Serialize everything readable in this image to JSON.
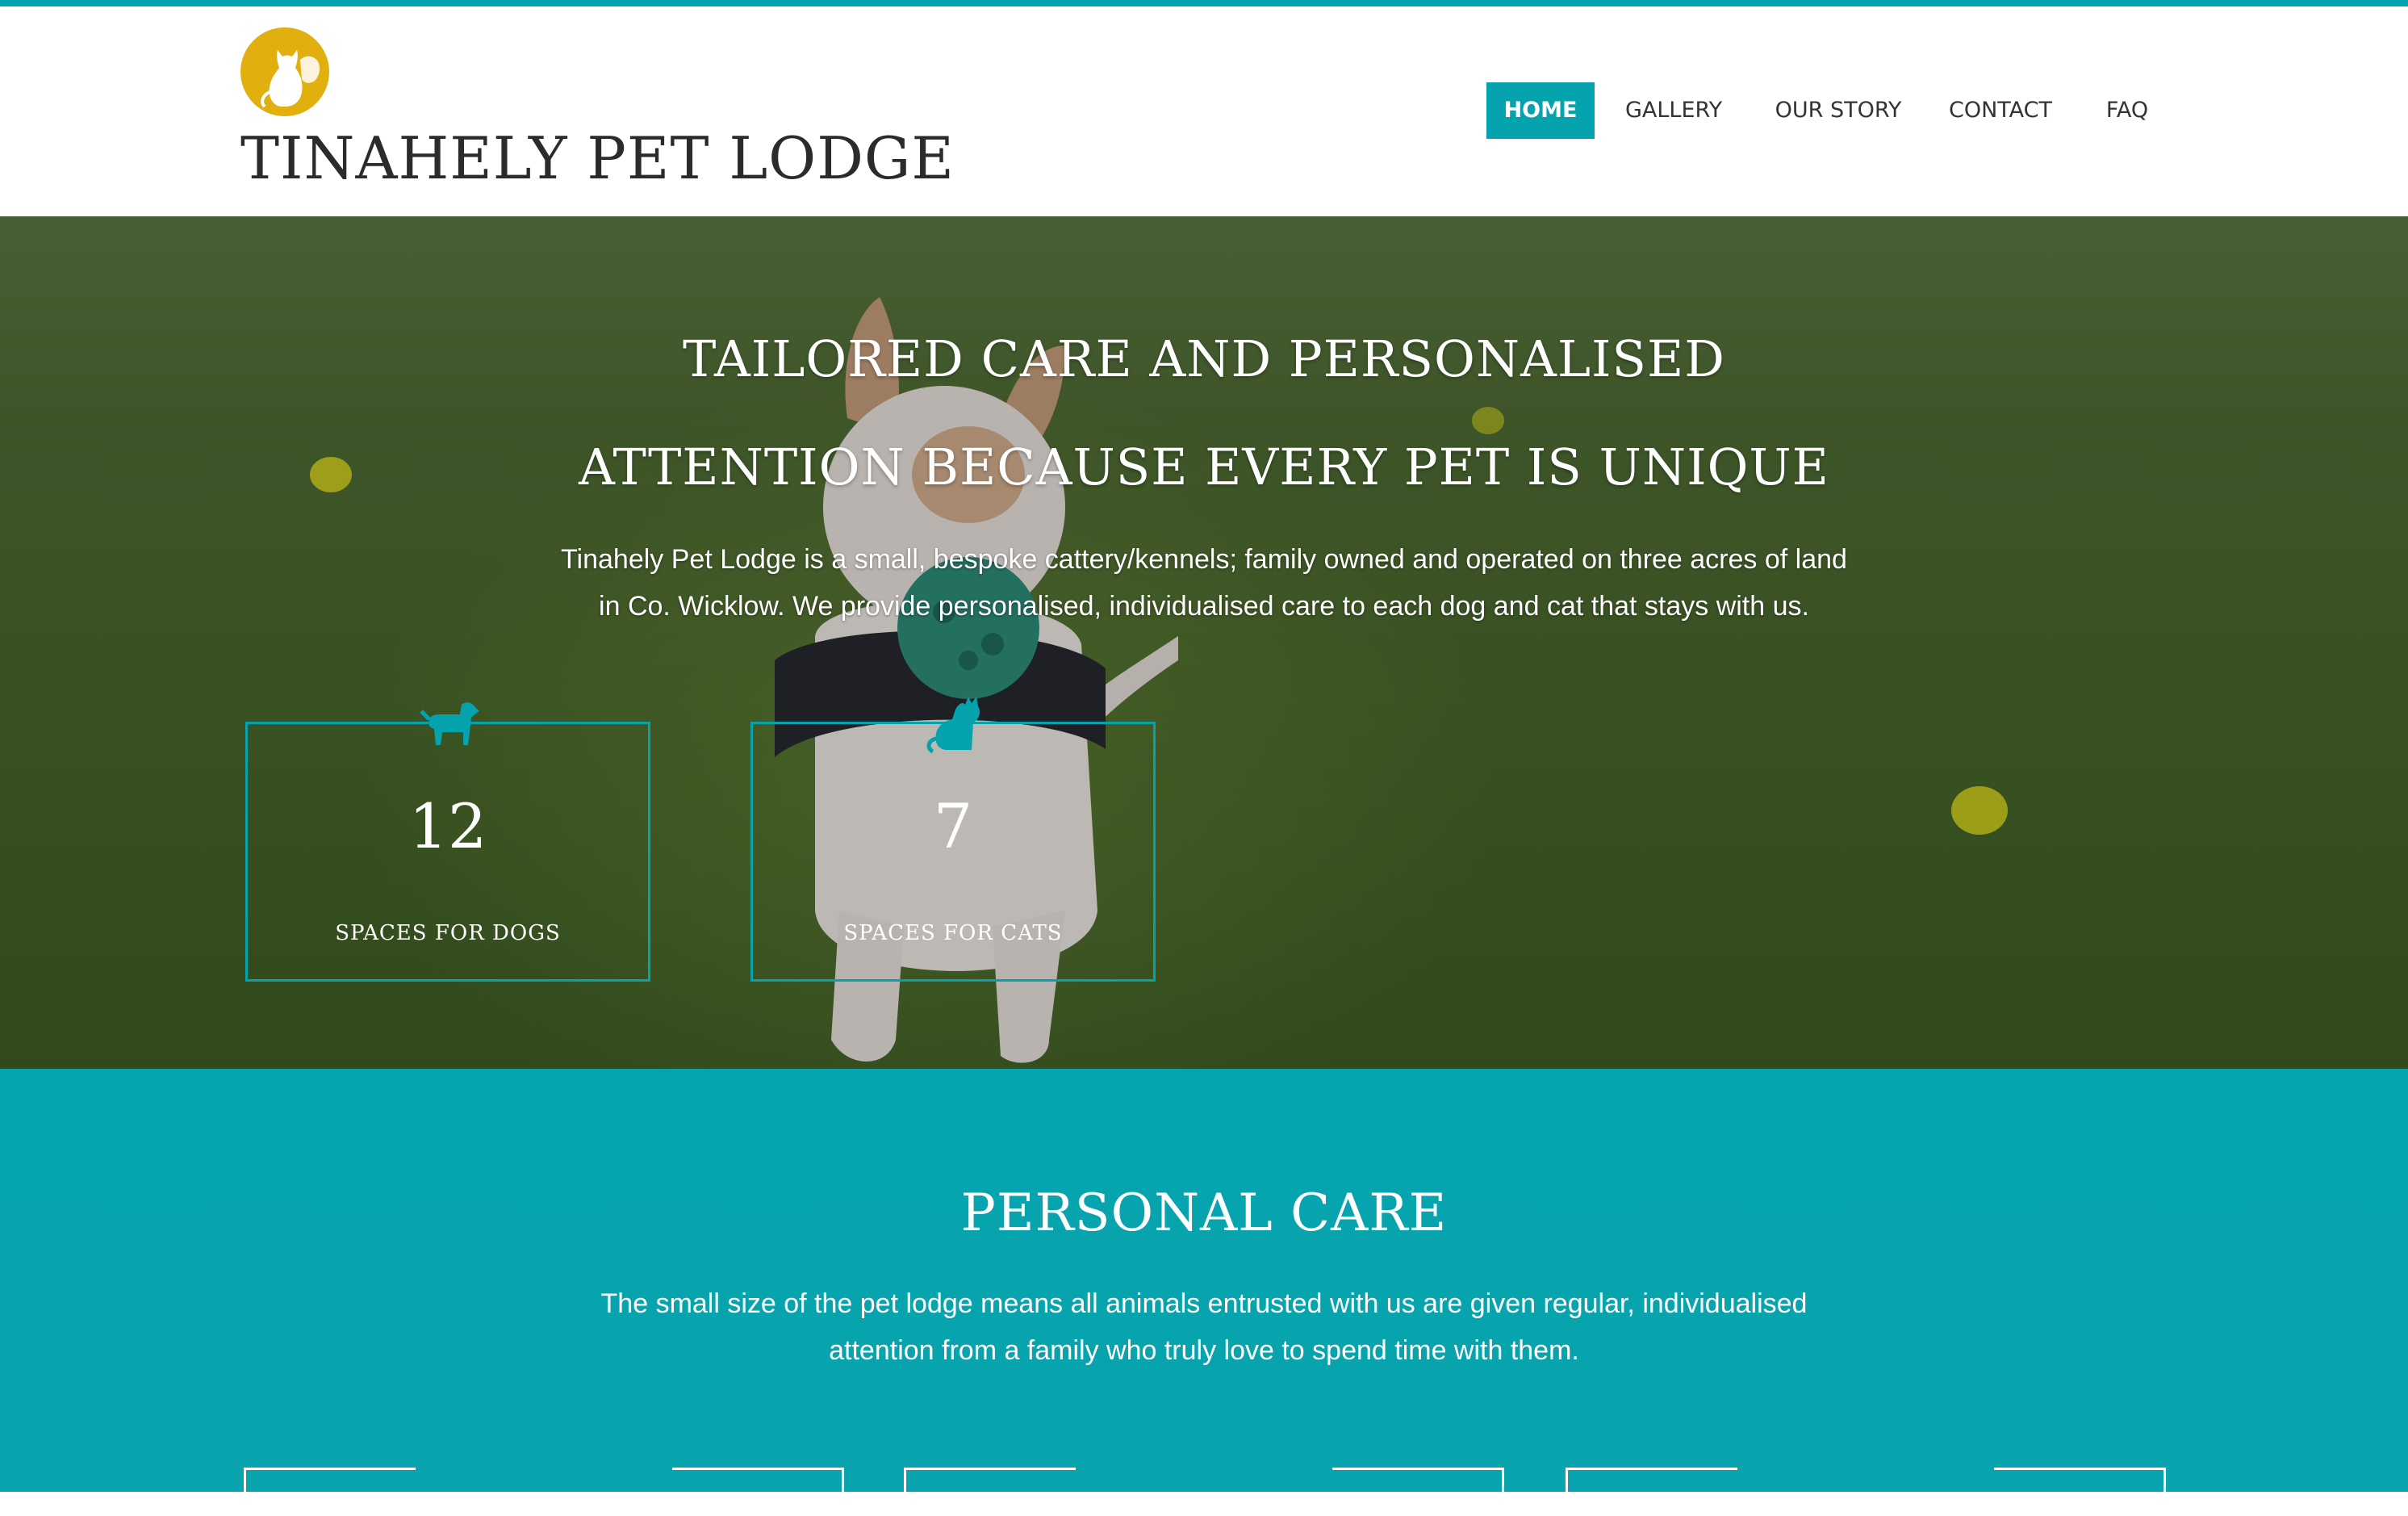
{
  "brand": {
    "name": "TINAHELY PET LODGE",
    "logo_icon": "cat-dog-silhouette-icon",
    "logo_color": "#e2b00e"
  },
  "colors": {
    "accent": "#04a3ad",
    "text_dark": "#2b2b2b"
  },
  "nav": {
    "items": [
      {
        "label": "HOME",
        "active": true
      },
      {
        "label": "GALLERY",
        "active": false
      },
      {
        "label": "OUR STORY",
        "active": false
      },
      {
        "label": "CONTACT",
        "active": false
      },
      {
        "label": "FAQ",
        "active": false
      }
    ]
  },
  "hero": {
    "title_line1": "TAILORED CARE AND PERSONALISED",
    "title_line2": "ATTENTION BECAUSE EVERY PET IS UNIQUE",
    "text_line1": "Tinahely Pet Lodge is a small, bespoke cattery/kennels; family owned and operated on three acres of land",
    "text_line2": "in Co. Wicklow. We provide personalised, individualised care to each dog and cat that stays with us.",
    "stats": [
      {
        "icon": "dog-icon",
        "value": "12",
        "label": "SPACES FOR DOGS"
      },
      {
        "icon": "cat-icon",
        "value": "7",
        "label": "SPACES FOR CATS"
      }
    ]
  },
  "care": {
    "title": "PERSONAL CARE",
    "text_line1": "The small size of the pet lodge means all animals entrusted with us are given regular, individualised",
    "text_line2": "attention from a family who truly love to spend time with them."
  }
}
